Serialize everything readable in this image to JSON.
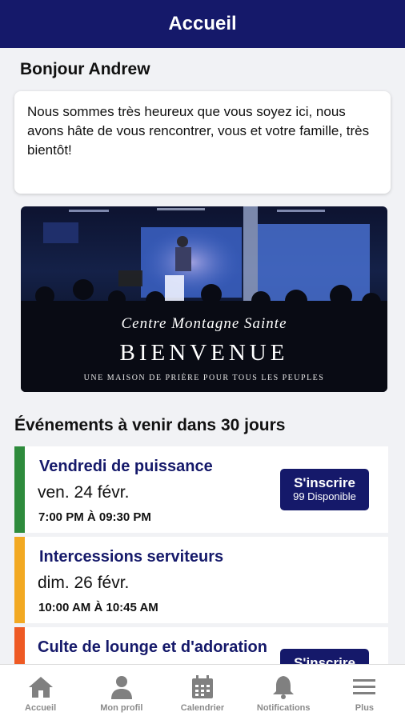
{
  "header": {
    "title": "Accueil"
  },
  "greeting": "Bonjour Andrew",
  "welcome_message": "Nous sommes très heureux que vous soyez ici, nous avons hâte de vous rencontrer, vous et votre famille, très bientôt!",
  "banner": {
    "script_text": "Centre Montagne Sainte",
    "title": "BIENVENUE",
    "subtitle": "UNE MAISON DE PRIÈRE POUR TOUS LES PEUPLES"
  },
  "events_section": {
    "title": "Événements à venir dans 30 jours"
  },
  "events": [
    {
      "title": "Vendredi de puissance",
      "date": "ven. 24 févr.",
      "time": "7:00 PM À 09:30 PM",
      "color": "#2e8b3c",
      "register": {
        "label": "S'inscrire",
        "available": "99 Disponible"
      }
    },
    {
      "title": "Intercessions serviteurs",
      "date": "dim. 26 févr.",
      "time": "10:00 AM À 10:45 AM",
      "color": "#f2a922"
    },
    {
      "title": "Culte de lounge et d'adoration",
      "date": "",
      "time": "",
      "color": "#ee5a24",
      "register": {
        "label": "S'inscrire",
        "available": ""
      }
    }
  ],
  "bottom_nav": [
    {
      "label": "Accueil",
      "icon": "home-icon"
    },
    {
      "label": "Mon profil",
      "icon": "user-icon"
    },
    {
      "label": "Calendrier",
      "icon": "calendar-icon"
    },
    {
      "label": "Notifications",
      "icon": "bell-icon"
    },
    {
      "label": "Plus",
      "icon": "menu-icon"
    }
  ],
  "colors": {
    "primary": "#15196a",
    "background": "#f1f2f5"
  }
}
